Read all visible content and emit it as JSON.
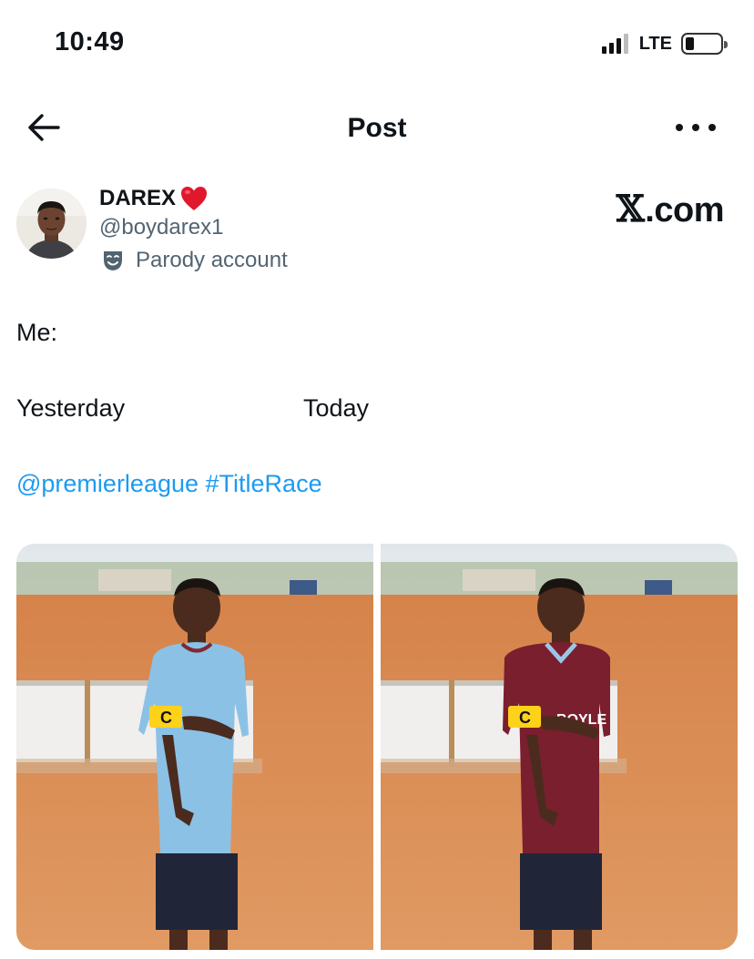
{
  "status_bar": {
    "time": "10:49",
    "network": "LTE",
    "signal_bars": 3,
    "signal_bars_max": 4,
    "battery_level": 0.2
  },
  "header": {
    "title": "Post",
    "back_icon": "arrow-left-icon",
    "more_icon": "ellipsis-icon"
  },
  "author": {
    "display_name": "DAREX",
    "display_emoji": "heart-emoji",
    "handle": "@boydarex1",
    "badge_label": "Parody account",
    "badge_icon": "theater-mask-icon"
  },
  "watermark": {
    "x_glyph": "𝕏",
    "text": ".com"
  },
  "tweet": {
    "line1": "Me:",
    "label_left": "Yesterday",
    "label_right": "Today",
    "mention": "@premierleague",
    "hashtag": "#TitleRace"
  },
  "colors": {
    "link": "#1d9bf0",
    "secondary_text": "#536471",
    "primary_text": "#0f1419",
    "jersey_left": "#7fb6df",
    "jersey_right": "#7a1f2e"
  },
  "media": {
    "count": 2
  }
}
